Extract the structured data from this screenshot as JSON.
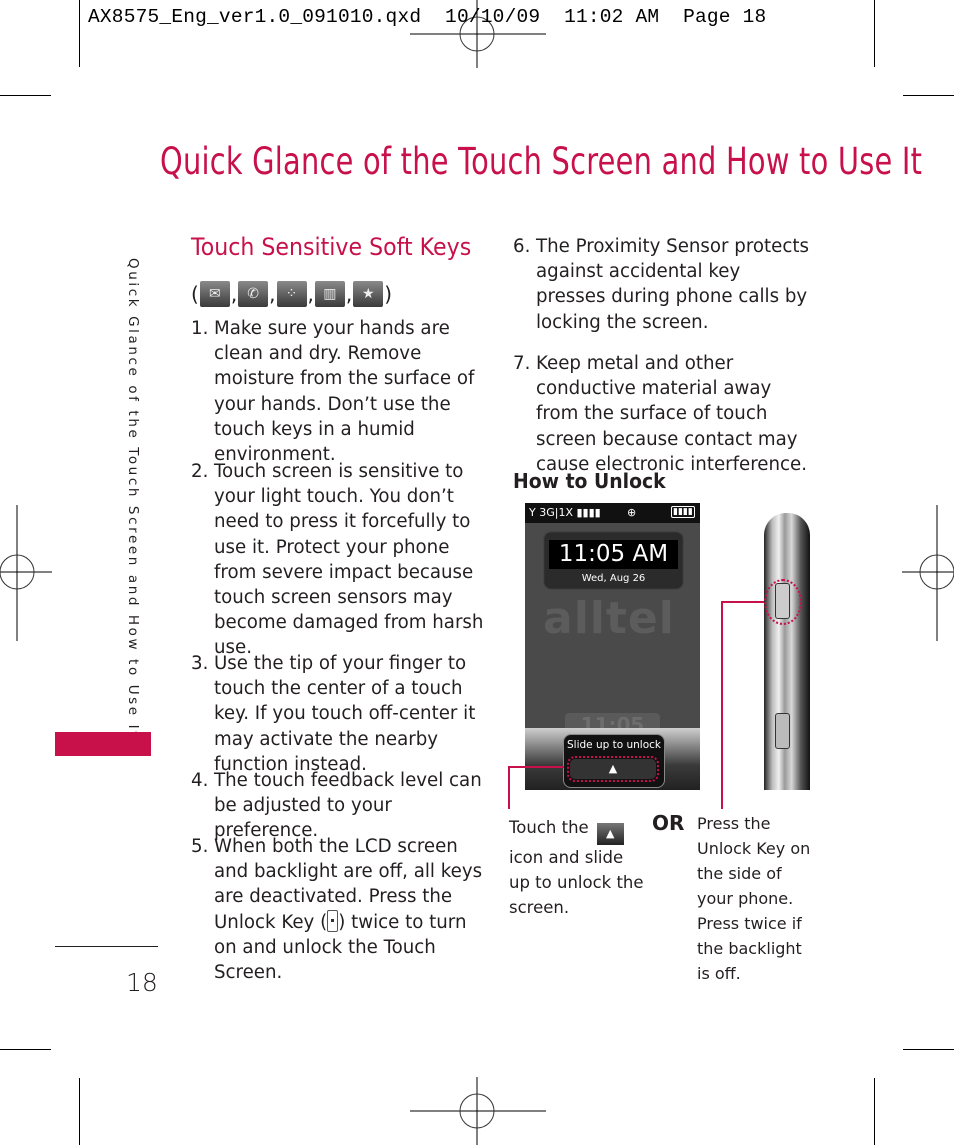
{
  "slug": {
    "text": "AX8575_Eng_ver1.0_091010.qxd  10/10/09  11:02 AM  Page 18"
  },
  "page": {
    "title": "Quick Glance of the Touch Screen and How to Use It",
    "side_tab_text": "Quick Glance of the Touch Screen and How to Use It",
    "page_number": "18",
    "accent_color": "#c8104b"
  },
  "soft_keys": {
    "heading": "Touch Sensitive Soft Keys",
    "open_paren": "(",
    "close_paren": ")",
    "separator": ",",
    "icons": [
      {
        "name": "messaging-icon",
        "glyph": "✉"
      },
      {
        "name": "phone-dial-icon",
        "glyph": "✆"
      },
      {
        "name": "menu-grid-icon",
        "glyph": "⁘"
      },
      {
        "name": "contacts-abc-icon",
        "glyph": "▥"
      },
      {
        "name": "favorites-contact-icon",
        "glyph": "★"
      }
    ]
  },
  "items": [
    {
      "num": "1.",
      "text": "Make sure your hands are clean and dry. Remove moisture from the surface of your hands. Don’t use the touch keys in a humid environment."
    },
    {
      "num": "2.",
      "text": "Touch screen is sensitive to your light touch. You don’t need to press it forcefully to use it. Protect your phone from severe impact because touch screen sensors may become damaged from harsh use."
    },
    {
      "num": "3.",
      "text": "Use the tip of your finger to touch the center of a touch key. If you touch off-center it may activate the nearby function instead."
    },
    {
      "num": "4.",
      "text": "The touch feedback level can be adjusted to your preference."
    },
    {
      "num": "5.",
      "text_before": "When both the LCD  screen and backlight are off, all keys are deactivated. Press the Unlock Key (",
      "text_after": ") twice to turn on and unlock the Touch Screen."
    },
    {
      "num": "6.",
      "text": "The Proximity Sensor protects against accidental key presses during phone calls by locking the screen."
    },
    {
      "num": "7.",
      "text": "Keep metal and other conductive material away from the surface of touch screen because contact may cause electronic interference."
    }
  ],
  "unlock": {
    "heading": "How to Unlock",
    "screen": {
      "status_left": "Y 3G|1X ▮▮▮▮",
      "status_center": "⊕",
      "battery": "▮▮▮▮",
      "time": "11:05 AM",
      "date": "Wed, Aug 26",
      "brand": "alltel",
      "ghost_time": "11:05",
      "slide_label": "Slide up to unlock",
      "slide_arrow": "▲"
    },
    "caption_left_before": "Touch the",
    "caption_left_after": "icon and slide up to unlock the screen.",
    "caption_icon_glyph": "▲",
    "or_label": "OR",
    "caption_right": "Press the Unlock Key on the side of your phone. Press twice if the backlight is off."
  }
}
